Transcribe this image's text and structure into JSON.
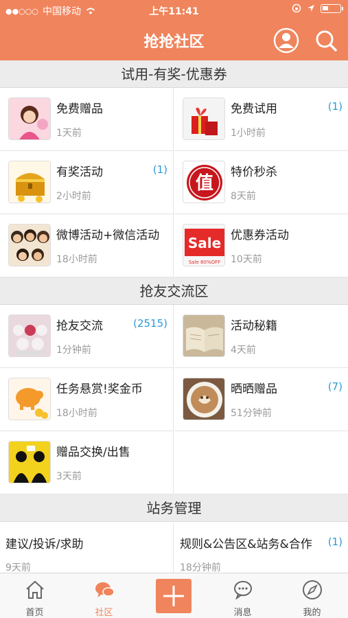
{
  "status": {
    "carrier": "中国移动",
    "time": "上午11:41"
  },
  "header": {
    "title": "抢抢社区"
  },
  "sections": [
    {
      "title": "试用-有奖-优惠券"
    },
    {
      "title": "抢友交流区"
    },
    {
      "title": "站务管理"
    }
  ],
  "forums": {
    "free_gift": {
      "name": "免费赠品",
      "time": "1天前"
    },
    "free_trial": {
      "name": "免费试用",
      "time": "1小时前",
      "count": "(1)"
    },
    "prize_event": {
      "name": "有奖活动",
      "time": "2小时前",
      "count": "(1)"
    },
    "flash_sale": {
      "name": "特价秒杀",
      "time": "8天前"
    },
    "weibo_wechat": {
      "name": "微博活动+微信活动",
      "time": "18小时前"
    },
    "coupon_event": {
      "name": "优惠券活动",
      "time": "10天前"
    },
    "friend_chat": {
      "name": "抢友交流",
      "time": "1分钟前",
      "count": "(2515)"
    },
    "event_tips": {
      "name": "活动秘籍",
      "time": "4天前"
    },
    "task_reward": {
      "name": "任务悬赏!奖金币",
      "time": "18小时前"
    },
    "show_gift": {
      "name": "晒晒赠品",
      "time": "51分钟前",
      "count": "(7)"
    },
    "gift_exchange": {
      "name": "赠品交换/出售",
      "time": "3天前"
    },
    "feedback": {
      "name": "建议/投诉/求助",
      "time": "9天前"
    },
    "rules": {
      "name": "规则&公告区&站务&合作",
      "time": "18分钟前",
      "count": "(1)"
    }
  },
  "thumb_text": {
    "sale": "Sale",
    "sale_sub": "Sale 80%OFF",
    "zhi": "值"
  },
  "tabs": [
    {
      "label": "首页"
    },
    {
      "label": "社区"
    },
    {
      "label": ""
    },
    {
      "label": "消息"
    },
    {
      "label": "我的"
    }
  ],
  "colors": {
    "accent": "#f0845c",
    "count": "#2b9ad6",
    "section_bg": "#ececec"
  }
}
